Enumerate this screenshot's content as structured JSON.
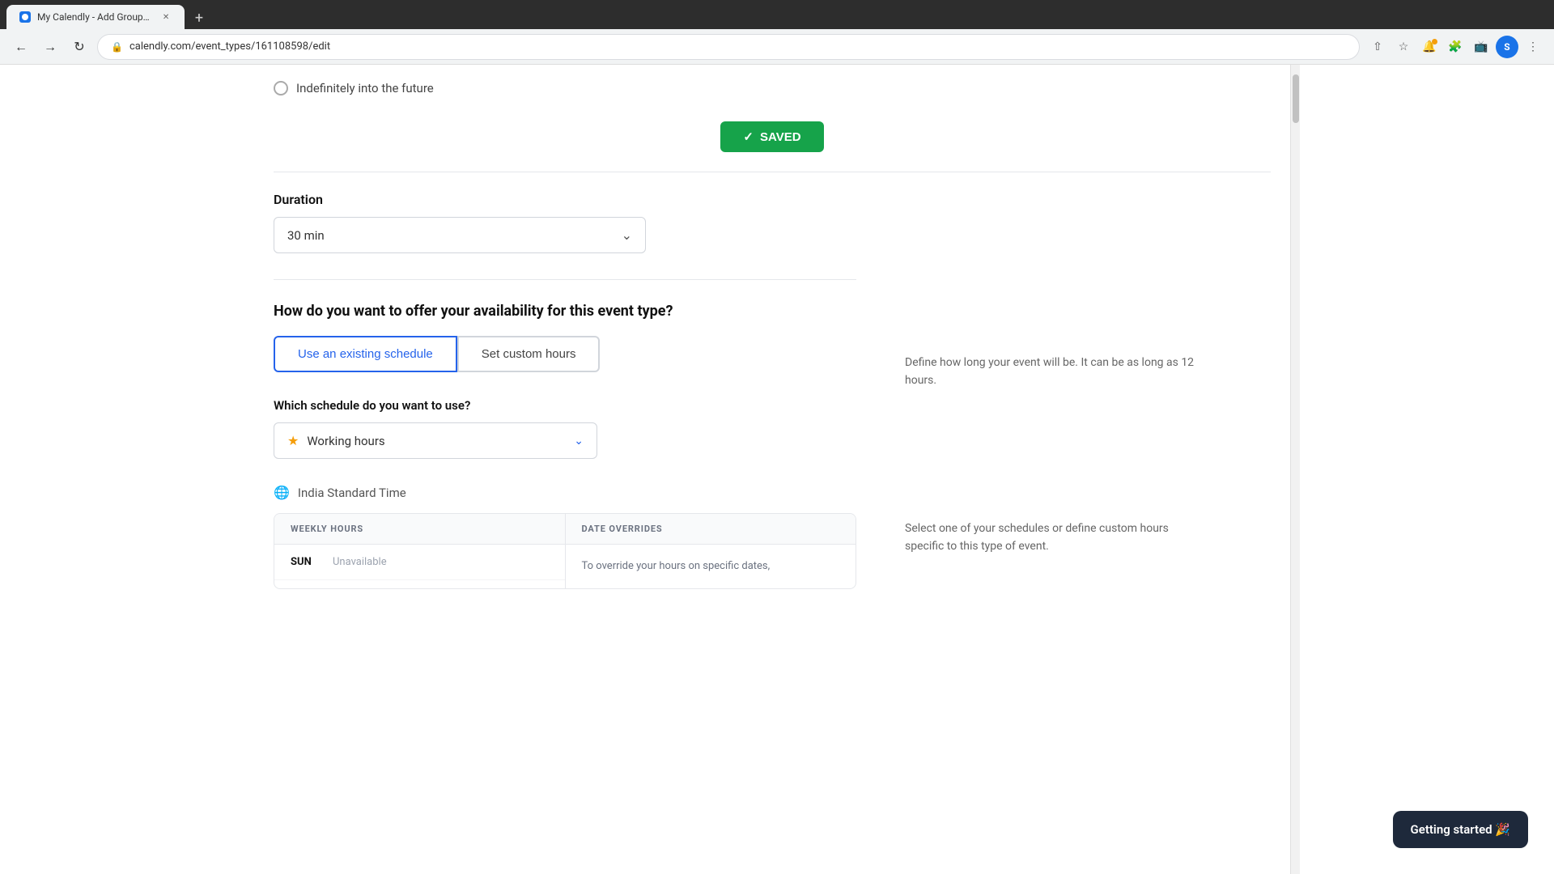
{
  "browser": {
    "tab_title": "My Calendly - Add Group Event",
    "url": "calendly.com/event_types/161108598/edit",
    "profile_initial": "S",
    "new_tab_label": "+"
  },
  "top": {
    "radio_label": "Indefinitely into the future",
    "saved_label": "SAVED"
  },
  "duration": {
    "label": "Duration",
    "value": "30 min",
    "help": "Define how long your event will be. It can be as long as 12 hours."
  },
  "availability": {
    "question": "How do you want to offer your availability for this event type?",
    "help": "Select one of your schedules or define custom hours specific to this type of event.",
    "options": [
      {
        "label": "Use an existing schedule",
        "active": true
      },
      {
        "label": "Set custom hours",
        "active": false
      }
    ]
  },
  "schedule": {
    "question": "Which schedule do you want to use?",
    "value": "Working hours",
    "star": "★"
  },
  "timezone": {
    "label": "India Standard Time",
    "icon": "🌐"
  },
  "weekly_hours": {
    "header": "WEEKLY HOURS",
    "days": [
      {
        "name": "SUN",
        "value": "Unavailable"
      }
    ]
  },
  "date_overrides": {
    "header": "DATE OVERRIDES",
    "text": "To override your hours on specific dates,"
  },
  "toast": {
    "label": "Getting started 🎉"
  }
}
